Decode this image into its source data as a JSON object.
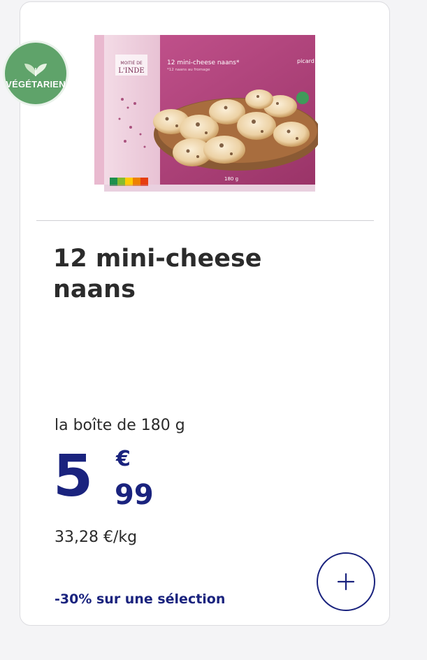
{
  "badge": {
    "label": "VÉGÉTARIEN",
    "icon": "leaf-icon",
    "color": "#5fa36a"
  },
  "product": {
    "name": "12 mini-cheese naans",
    "image": {
      "box_title": "12 mini-cheese naans*",
      "box_subtitle": "*12 naans au fromage",
      "brand_line1": "MOITIÉ DE",
      "brand_line2": "L'INDE",
      "nutriscore": [
        "A",
        "B",
        "C",
        "D",
        "E"
      ],
      "weight": "180 g",
      "logo": "picard",
      "box_color": "#b5467f"
    }
  },
  "pricing": {
    "unit_label": "la boîte de 180 g",
    "price_int": "5",
    "price_currency": "€",
    "price_dec": "99",
    "per_kg": "33,28 €/kg",
    "promo": "-30% sur une sélection",
    "accent_color": "#1a237e"
  },
  "actions": {
    "add_icon": "plus-icon"
  }
}
